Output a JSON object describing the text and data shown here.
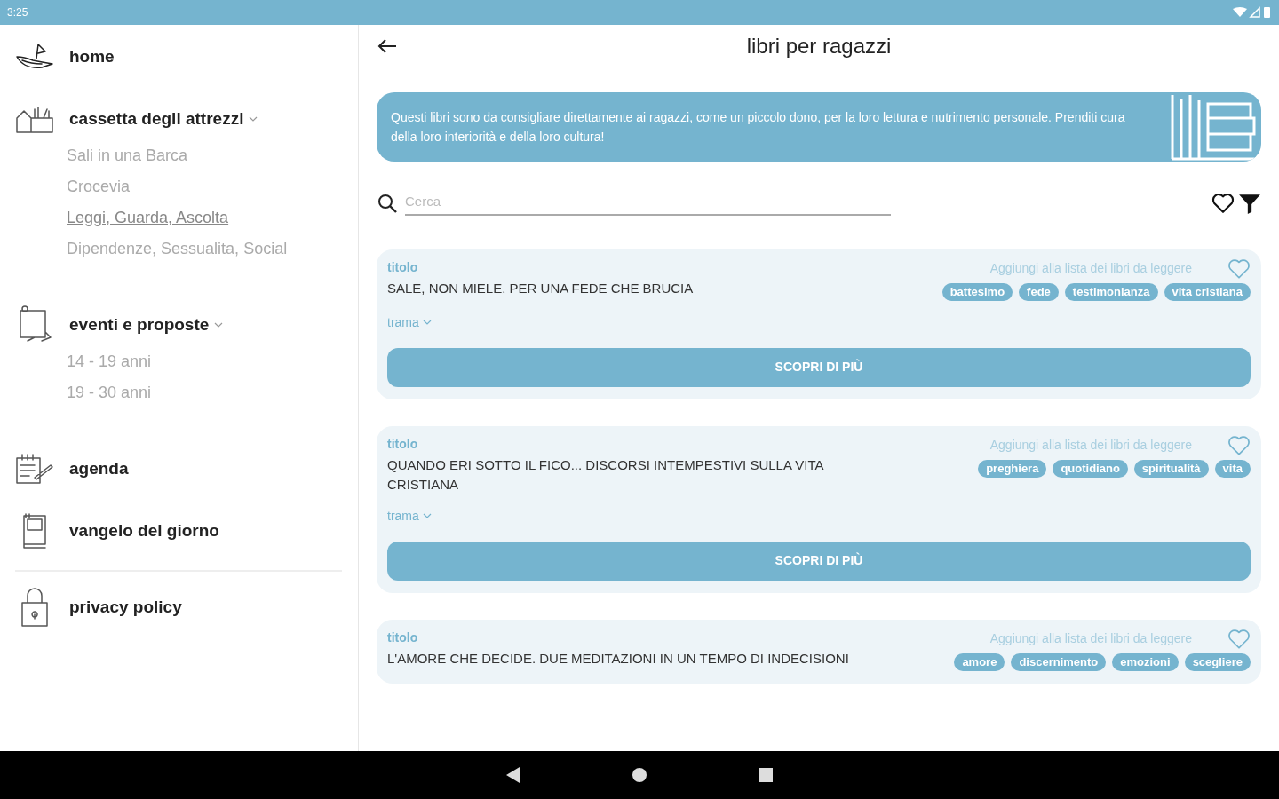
{
  "status_bar": {
    "time": "3:25"
  },
  "sidebar": {
    "items": [
      {
        "label": "home",
        "expanded": false
      },
      {
        "label": "cassetta degli attrezzi",
        "expanded": true,
        "children": [
          {
            "label": "Sali in una Barca",
            "selected": false
          },
          {
            "label": "Crocevia",
            "selected": false
          },
          {
            "label": "Leggi, Guarda, Ascolta",
            "selected": true
          },
          {
            "label": "Dipendenze, Sessualita, Social",
            "selected": false
          }
        ]
      },
      {
        "label": "eventi e proposte",
        "expanded": true,
        "children": [
          {
            "label": "14 - 19 anni",
            "selected": false
          },
          {
            "label": "19 - 30 anni",
            "selected": false
          }
        ]
      },
      {
        "label": "agenda",
        "expanded": false
      },
      {
        "label": "vangelo del giorno",
        "expanded": false
      }
    ],
    "footer_items": [
      {
        "label": "privacy policy"
      }
    ]
  },
  "header": {
    "title": "libri per ragazzi"
  },
  "banner": {
    "text_before": "Questi libri sono ",
    "link": "da consigliare direttamente ai ragazzi",
    "text_after": ", come un piccolo dono, per la loro lettura e nutrimento personale. Prenditi cura della loro interiorità e della loro cultura!"
  },
  "search": {
    "placeholder": "Cerca"
  },
  "books": [
    {
      "label": "titolo",
      "title": "SALE, NON MIELE. PER UNA FEDE CHE BRUCIA",
      "add_label": "Aggiungi alla lista dei libri da leggere",
      "favorite": false,
      "tags": [
        "battesimo",
        "fede",
        "testimonianza",
        "vita cristiana"
      ],
      "plot_label": "trama",
      "button": "SCOPRI DI PIÙ"
    },
    {
      "label": "titolo",
      "title": "QUANDO ERI SOTTO IL FICO... DISCORSI INTEMPESTIVI SULLA VITA CRISTIANA",
      "add_label": "Aggiungi alla lista dei libri da leggere",
      "favorite": false,
      "tags": [
        "preghiera",
        "quotidiano",
        "spiritualità",
        "vita"
      ],
      "plot_label": "trama",
      "button": "SCOPRI DI PIÙ"
    },
    {
      "label": "titolo",
      "title": "L'AMORE CHE DECIDE. DUE MEDITAZIONI IN UN TEMPO DI INDECISIONI",
      "add_label": "Aggiungi alla lista dei libri da leggere",
      "favorite": false,
      "tags": [
        "amore",
        "discernimento",
        "emozioni",
        "scegliere"
      ]
    }
  ]
}
